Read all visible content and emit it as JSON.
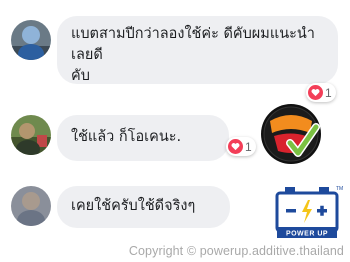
{
  "comments": [
    {
      "text": "แบตสามปีกว่าลองใช้ค่ะ ดีคับผมแนะนำเลยดี\nคับ",
      "reaction_count": "1"
    },
    {
      "text": "ใช้แล้ว ก็โอเคนะ.",
      "reaction_count": "1"
    },
    {
      "text": "เคยใช้ครับใช้ดีจริงๆ"
    }
  ],
  "watermark": {
    "prefix": "Copyright ©",
    "domain": "powerup.additive.thailand"
  },
  "colors": {
    "bubble": "#eeeff2",
    "heart": "#f33e58",
    "badge_orange": "#f28c1e",
    "badge_red": "#d9232d",
    "check_green": "#7bc142",
    "logo_blue": "#1e4a9c"
  },
  "icons": [
    "heart-icon",
    "genuine-badge",
    "battery-logo"
  ]
}
